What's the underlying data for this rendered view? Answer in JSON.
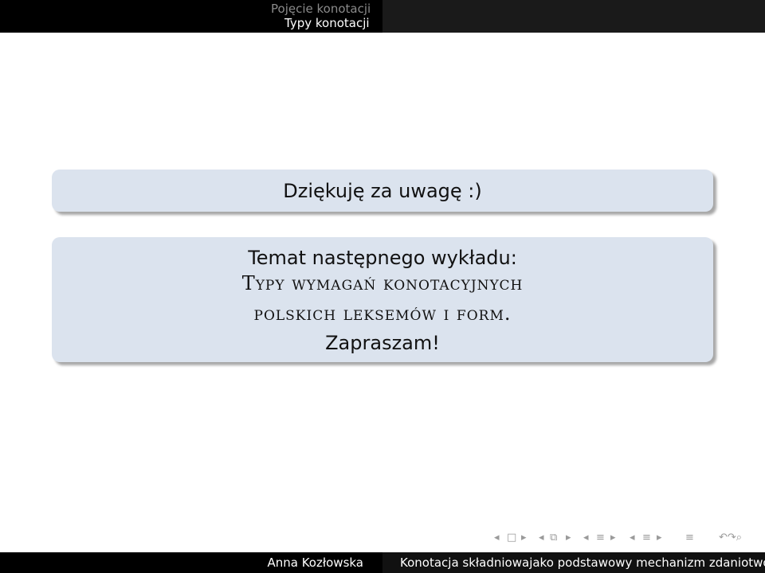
{
  "header": {
    "section": "Pojęcie konotacji",
    "subsection": "Typy konotacji"
  },
  "thanks_block": {
    "text": "Dziękuję za uwagę :)"
  },
  "next_block": {
    "topic": "Temat następnego wykładu:",
    "title_line1": "Typy wymagań konotacyjnych",
    "title_line2": "polskich leksemów i form.",
    "invite": "Zapraszam!"
  },
  "nav_symbols": {
    "frame_prev": "◂",
    "frame_icon": "□",
    "frame_next": "▸",
    "sub_prev": "◂",
    "sub_icon": "⧉",
    "sub_next": "▸",
    "sec_prev": "◂",
    "sec_icon": "≡",
    "sec_next": "▸",
    "subsec_prev": "◂",
    "subsec_icon": "≡",
    "subsec_next": "▸",
    "align_icon": "≡",
    "search_icons": "↶↷⌕"
  },
  "footer": {
    "author": "Anna Kozłowska",
    "title": "Konotacja składniowajako podstawowy mechanizm zdaniotwórczy"
  }
}
